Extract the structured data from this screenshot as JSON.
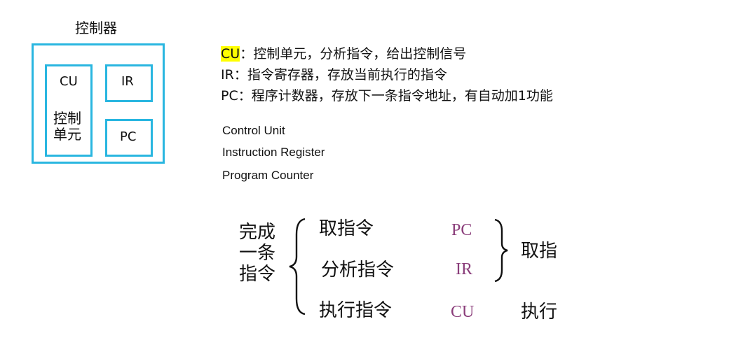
{
  "controller": {
    "title": "控制器",
    "cu_label": "CU",
    "cu_sub_line1": "控制",
    "cu_sub_line2": "单元",
    "ir_label": "IR",
    "pc_label": "PC",
    "border_color": "#29b6e0"
  },
  "definitions": [
    {
      "abbr": "CU",
      "text": "：控制单元，分析指令，给出控制信号"
    },
    {
      "abbr": "IR",
      "text": "：指令寄存器，存放当前执行的指令"
    },
    {
      "abbr": "PC",
      "text": "：程序计数器，存放下一条指令地址，有自动加1功能"
    }
  ],
  "english_names": [
    "Control Unit",
    "Instruction Register",
    "Program Counter"
  ],
  "cycle": {
    "left_line1": "完成",
    "left_line2": "一条",
    "left_line3": "指令",
    "steps": [
      "取指令",
      "分析指令",
      "执行指令"
    ],
    "registers": [
      "PC",
      "IR",
      "CU"
    ],
    "phase_fetch": "取指",
    "phase_exec": "执行",
    "register_color": "#8a3d7a"
  }
}
